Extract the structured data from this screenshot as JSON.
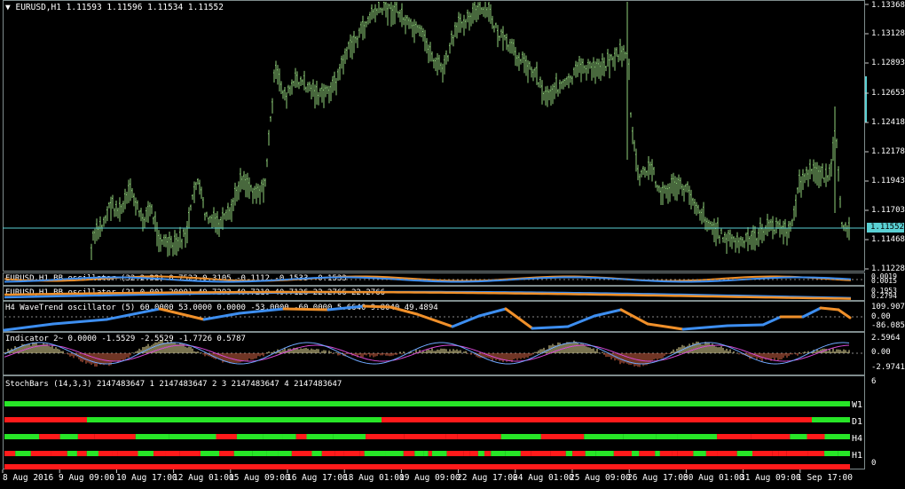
{
  "main": {
    "title": "EURUSD,H1  1.11593 1.11596 1.11534 1.11552",
    "current_price": "1.11552",
    "yaxis": [
      "1.13368",
      "1.13128",
      "1.12893",
      "1.12653",
      "1.12418",
      "1.12178",
      "1.11943",
      "1.11703",
      "1.11468",
      "1.11228"
    ]
  },
  "bb1": {
    "title": "EURUSD,H1  BB oscillator (32.2.32) 0.7523 0.3105 -0.1112 -0.1533 -0.1533",
    "y1": "0.0019",
    "y2": "0.0015",
    "y3": "-0.0019"
  },
  "bb2": {
    "title": "EURUSD,H1  BB oscillator (21.0.001.2000) 40.7293 40.7210 40.7126 22.2766 22.2766",
    "y1": "0.1953",
    "y2": "0.2794"
  },
  "wt": {
    "title": "H4 WaveTrend oscillator (5) 60.0000 53.0000 0.0000 -53.0000 -60.0000 5.6640 9.8040 49.4894",
    "y1": "109.907",
    "y2": "0.00",
    "y3": "-86.0856"
  },
  "ind2": {
    "title": "Indicator 2~ 0.0000 -1.5529 -2.5529 -1.7726 0.5787",
    "y1": "2.5964",
    "y2": "0.00",
    "y3": "-2.9741"
  },
  "stoch": {
    "title": "StochBars (14,3,3) 2147483647 1 2147483647 2 3 2147483647 4 2147483647",
    "y_top": "6",
    "y_bottom": "0",
    "rows": [
      "W1",
      "D1",
      "H4",
      "H1"
    ]
  },
  "xaxis": [
    "8 Aug 2016",
    "9 Aug 09:00",
    "10 Aug 17:00",
    "12 Aug 01:00",
    "15 Aug 09:00",
    "16 Aug 17:00",
    "18 Aug 01:00",
    "19 Aug 09:00",
    "22 Aug 17:00",
    "24 Aug 01:00",
    "25 Aug 09:00",
    "26 Aug 17:00",
    "30 Aug 01:00",
    "31 Aug 09:00",
    "1 Sep 17:00"
  ],
  "colors": {
    "candle": "#8fd17a",
    "blue": "#3d8ef0",
    "orange": "#f0902a",
    "green": "#27e627",
    "red": "#ff1a1a",
    "magenta": "#d548d5",
    "histo_pos": "#f2e6a0",
    "histo_neg": "#e06a4a"
  }
}
